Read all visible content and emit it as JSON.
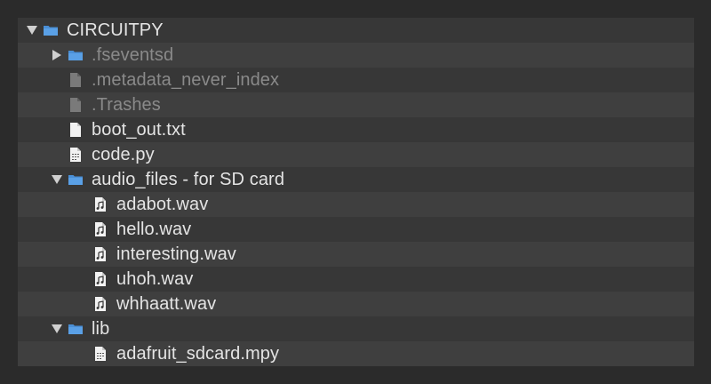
{
  "tree": {
    "items": [
      {
        "label": "CIRCUITPY",
        "depth": 0,
        "disclosure": "expanded",
        "icon": "folder-icon",
        "dim": false
      },
      {
        "label": ".fseventsd",
        "depth": 1,
        "disclosure": "collapsed",
        "icon": "folder-icon",
        "dim": true
      },
      {
        "label": ".metadata_never_index",
        "depth": 1,
        "disclosure": "none",
        "icon": "file-icon",
        "dim": true
      },
      {
        "label": ".Trashes",
        "depth": 1,
        "disclosure": "none",
        "icon": "file-icon",
        "dim": true
      },
      {
        "label": "boot_out.txt",
        "depth": 1,
        "disclosure": "none",
        "icon": "text-file-icon",
        "dim": false
      },
      {
        "label": "code.py",
        "depth": 1,
        "disclosure": "none",
        "icon": "binary-file-icon",
        "dim": false
      },
      {
        "label": "audio_files - for SD card",
        "depth": 1,
        "disclosure": "expanded",
        "icon": "folder-icon",
        "dim": false
      },
      {
        "label": "adabot.wav",
        "depth": 2,
        "disclosure": "none",
        "icon": "audio-file-icon",
        "dim": false
      },
      {
        "label": "hello.wav",
        "depth": 2,
        "disclosure": "none",
        "icon": "audio-file-icon",
        "dim": false
      },
      {
        "label": "interesting.wav",
        "depth": 2,
        "disclosure": "none",
        "icon": "audio-file-icon",
        "dim": false
      },
      {
        "label": "uhoh.wav",
        "depth": 2,
        "disclosure": "none",
        "icon": "audio-file-icon",
        "dim": false
      },
      {
        "label": "whhaatt.wav",
        "depth": 2,
        "disclosure": "none",
        "icon": "audio-file-icon",
        "dim": false
      },
      {
        "label": "lib",
        "depth": 1,
        "disclosure": "expanded",
        "icon": "folder-icon",
        "dim": false
      },
      {
        "label": "adafruit_sdcard.mpy",
        "depth": 2,
        "disclosure": "none",
        "icon": "binary-file-icon",
        "dim": false
      }
    ]
  },
  "colors": {
    "folder": "#4a8fd6",
    "text": "#e4e4e4",
    "dim_text": "#8a8a8a",
    "disclosure": "#d0d0d0"
  }
}
